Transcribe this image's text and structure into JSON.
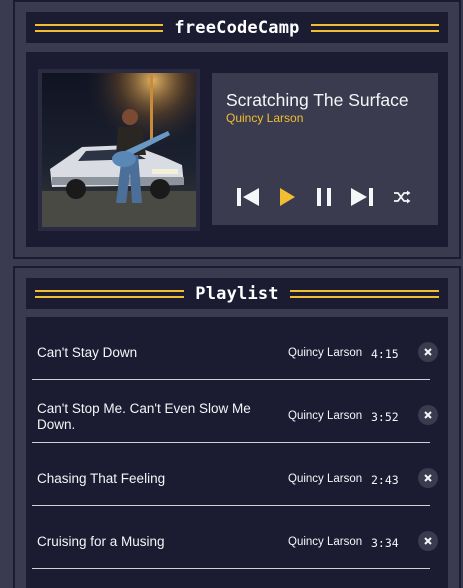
{
  "app": {
    "title": "freeCodeCamp"
  },
  "player": {
    "song_title": "Scratching The Surface",
    "artist": "Quincy Larson",
    "album_art": "album-art-icon",
    "controls": [
      {
        "name": "previous",
        "icon": "previous-icon"
      },
      {
        "name": "play",
        "icon": "play-icon"
      },
      {
        "name": "pause",
        "icon": "pause-icon"
      },
      {
        "name": "next",
        "icon": "next-icon"
      },
      {
        "name": "shuffle",
        "icon": "shuffle-icon"
      }
    ]
  },
  "playlist": {
    "title": "Playlist",
    "songs": [
      {
        "title": "Can't Stay Down",
        "artist": "Quincy Larson",
        "duration": "4:15"
      },
      {
        "title": "Can't Stop Me. Can't Even Slow Me Down.",
        "artist": "Quincy Larson",
        "duration": "3:52"
      },
      {
        "title": "Chasing That Feeling",
        "artist": "Quincy Larson",
        "duration": "2:43"
      },
      {
        "title": "Cruising for a Musing",
        "artist": "Quincy Larson",
        "duration": "3:34"
      }
    ]
  },
  "colors": {
    "background": "#3b3b4f",
    "dark": "#1b1b32",
    "accent": "#f1be32",
    "text": "#f5f6f7"
  }
}
